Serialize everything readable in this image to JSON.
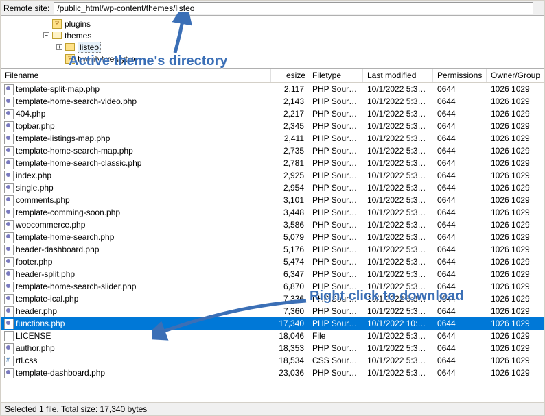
{
  "remote_site_label": "Remote site:",
  "remote_path": "/public_html/wp-content/themes/listeo",
  "tree": {
    "plugins": {
      "label": "plugins"
    },
    "themes": {
      "label": "themes"
    },
    "listeo": {
      "label": "listeo"
    },
    "twentytwentytwo": {
      "label": "twentytwentytwo"
    }
  },
  "columns": {
    "name": "Filename",
    "size": "esize",
    "type": "Filetype",
    "mod": "Last modified",
    "perm": "Permissions",
    "own": "Owner/Group"
  },
  "files": [
    {
      "name": "template-split-map.php",
      "size": "2,117",
      "type": "PHP Sourc...",
      "mod": "10/1/2022 5:35:...",
      "perm": "0644",
      "own": "1026 1029",
      "icon": "php",
      "sel": false
    },
    {
      "name": "template-home-search-video.php",
      "size": "2,143",
      "type": "PHP Sourc...",
      "mod": "10/1/2022 5:35:...",
      "perm": "0644",
      "own": "1026 1029",
      "icon": "php",
      "sel": false
    },
    {
      "name": "404.php",
      "size": "2,217",
      "type": "PHP Sourc...",
      "mod": "10/1/2022 5:35:...",
      "perm": "0644",
      "own": "1026 1029",
      "icon": "php",
      "sel": false
    },
    {
      "name": "topbar.php",
      "size": "2,345",
      "type": "PHP Sourc...",
      "mod": "10/1/2022 5:35:...",
      "perm": "0644",
      "own": "1026 1029",
      "icon": "php",
      "sel": false
    },
    {
      "name": "template-listings-map.php",
      "size": "2,411",
      "type": "PHP Sourc...",
      "mod": "10/1/2022 5:35:...",
      "perm": "0644",
      "own": "1026 1029",
      "icon": "php",
      "sel": false
    },
    {
      "name": "template-home-search-map.php",
      "size": "2,735",
      "type": "PHP Sourc...",
      "mod": "10/1/2022 5:35:...",
      "perm": "0644",
      "own": "1026 1029",
      "icon": "php",
      "sel": false
    },
    {
      "name": "template-home-search-classic.php",
      "size": "2,781",
      "type": "PHP Sourc...",
      "mod": "10/1/2022 5:35:...",
      "perm": "0644",
      "own": "1026 1029",
      "icon": "php",
      "sel": false
    },
    {
      "name": "index.php",
      "size": "2,925",
      "type": "PHP Sourc...",
      "mod": "10/1/2022 5:35:...",
      "perm": "0644",
      "own": "1026 1029",
      "icon": "php",
      "sel": false
    },
    {
      "name": "single.php",
      "size": "2,954",
      "type": "PHP Sourc...",
      "mod": "10/1/2022 5:35:...",
      "perm": "0644",
      "own": "1026 1029",
      "icon": "php",
      "sel": false
    },
    {
      "name": "comments.php",
      "size": "3,101",
      "type": "PHP Sourc...",
      "mod": "10/1/2022 5:35:...",
      "perm": "0644",
      "own": "1026 1029",
      "icon": "php",
      "sel": false
    },
    {
      "name": "template-comming-soon.php",
      "size": "3,448",
      "type": "PHP Sourc...",
      "mod": "10/1/2022 5:35:...",
      "perm": "0644",
      "own": "1026 1029",
      "icon": "php",
      "sel": false
    },
    {
      "name": "woocommerce.php",
      "size": "3,586",
      "type": "PHP Sourc...",
      "mod": "10/1/2022 5:35:...",
      "perm": "0644",
      "own": "1026 1029",
      "icon": "php",
      "sel": false
    },
    {
      "name": "template-home-search.php",
      "size": "5,079",
      "type": "PHP Sourc...",
      "mod": "10/1/2022 5:35:...",
      "perm": "0644",
      "own": "1026 1029",
      "icon": "php",
      "sel": false
    },
    {
      "name": "header-dashboard.php",
      "size": "5,176",
      "type": "PHP Sourc...",
      "mod": "10/1/2022 5:35:...",
      "perm": "0644",
      "own": "1026 1029",
      "icon": "php",
      "sel": false
    },
    {
      "name": "footer.php",
      "size": "5,474",
      "type": "PHP Sourc...",
      "mod": "10/1/2022 5:35:...",
      "perm": "0644",
      "own": "1026 1029",
      "icon": "php",
      "sel": false
    },
    {
      "name": "header-split.php",
      "size": "6,347",
      "type": "PHP Sourc...",
      "mod": "10/1/2022 5:35:...",
      "perm": "0644",
      "own": "1026 1029",
      "icon": "php",
      "sel": false
    },
    {
      "name": "template-home-search-slider.php",
      "size": "6,870",
      "type": "PHP Sourc...",
      "mod": "10/1/2022 5:35:...",
      "perm": "0644",
      "own": "1026 1029",
      "icon": "php",
      "sel": false
    },
    {
      "name": "template-ical.php",
      "size": "7,336",
      "type": "PHP Sourc...",
      "mod": "10/1/2022 5:35:...",
      "perm": "0644",
      "own": "1026 1029",
      "icon": "php",
      "sel": false
    },
    {
      "name": "header.php",
      "size": "7,360",
      "type": "PHP Sourc...",
      "mod": "10/1/2022 5:35:...",
      "perm": "0644",
      "own": "1026 1029",
      "icon": "php",
      "sel": false
    },
    {
      "name": "functions.php",
      "size": "17,340",
      "type": "PHP Sourc...",
      "mod": "10/1/2022 10:0...",
      "perm": "0644",
      "own": "1026 1029",
      "icon": "php",
      "sel": true
    },
    {
      "name": "LICENSE",
      "size": "18,046",
      "type": "File",
      "mod": "10/1/2022 5:35:...",
      "perm": "0644",
      "own": "1026 1029",
      "icon": "file",
      "sel": false
    },
    {
      "name": "author.php",
      "size": "18,353",
      "type": "PHP Sourc...",
      "mod": "10/1/2022 5:35:...",
      "perm": "0644",
      "own": "1026 1029",
      "icon": "php",
      "sel": false
    },
    {
      "name": "rtl.css",
      "size": "18,534",
      "type": "CSS Sourc...",
      "mod": "10/1/2022 5:35:...",
      "perm": "0644",
      "own": "1026 1029",
      "icon": "css",
      "sel": false
    },
    {
      "name": "template-dashboard.php",
      "size": "23,036",
      "type": "PHP Sourc...",
      "mod": "10/1/2022 5:35:...",
      "perm": "0644",
      "own": "1026 1029",
      "icon": "php",
      "sel": false
    }
  ],
  "status_text": "Selected 1 file. Total size: 17,340 bytes",
  "annotations": {
    "top": "Active theme's directory",
    "middle": "Right click to download"
  }
}
